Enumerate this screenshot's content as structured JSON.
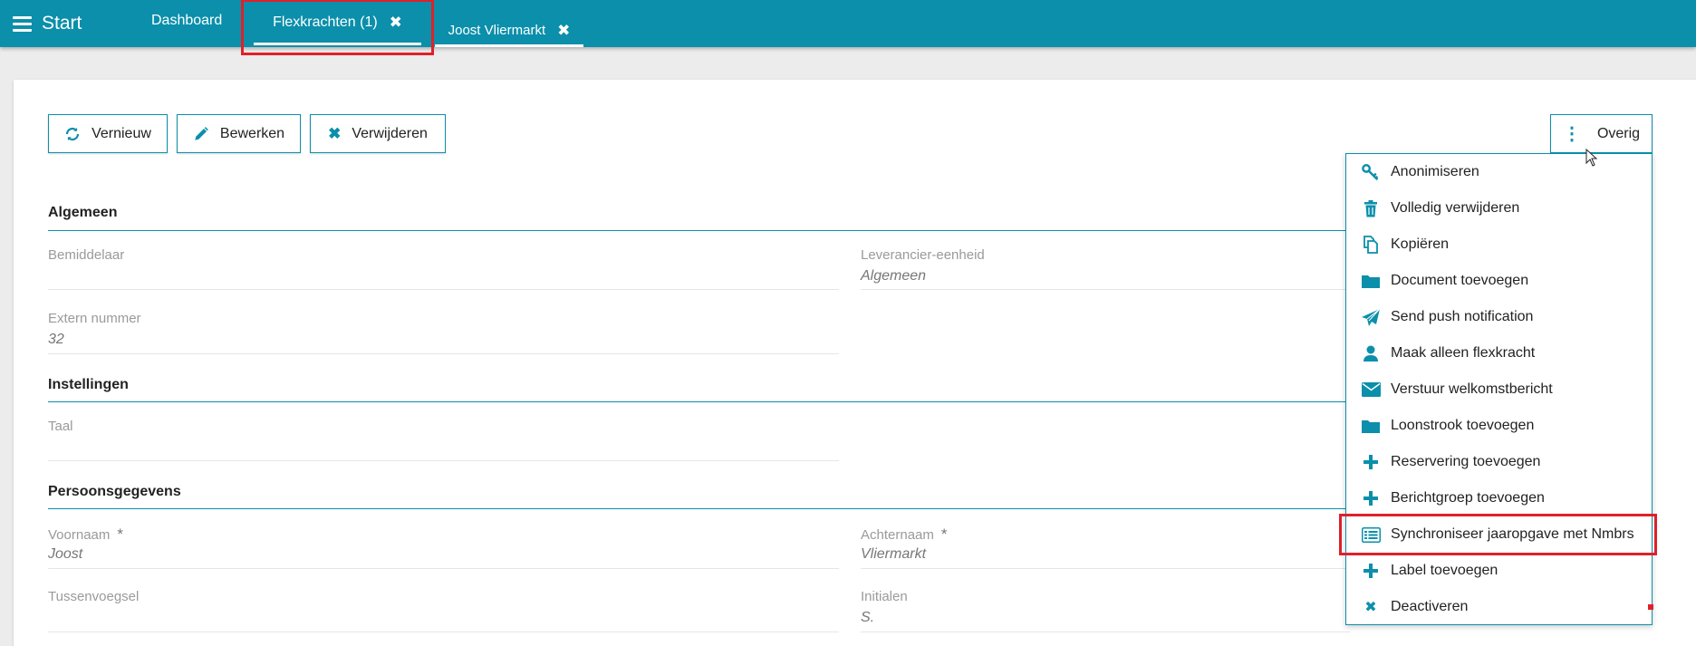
{
  "topbar": {
    "start_label": "Start",
    "tabs": [
      {
        "label": "Dashboard"
      },
      {
        "label": "Flexkrachten (1)"
      },
      {
        "label": "Joost Vliermarkt"
      }
    ]
  },
  "toolbar": {
    "refresh_label": "Vernieuw",
    "edit_label": "Bewerken",
    "delete_label": "Verwijderen",
    "more_label": "Overig"
  },
  "sections": {
    "general": {
      "title": "Algemeen",
      "bemiddelaar_label": "Bemiddelaar",
      "bemiddelaar_value": "",
      "leverancier_label": "Leverancier-eenheid",
      "leverancier_value": "Algemeen",
      "extern_label": "Extern nummer",
      "extern_value": "32"
    },
    "settings": {
      "title": "Instellingen",
      "taal_label": "Taal",
      "taal_value": ""
    },
    "personal": {
      "title": "Persoonsgegevens",
      "voornaam_label": "Voornaam",
      "voornaam_value": "Joost",
      "achternaam_label": "Achternaam",
      "achternaam_value": "Vliermarkt",
      "tussenvoegsel_label": "Tussenvoegsel",
      "tussenvoegsel_value": "",
      "initialen_label": "Initialen",
      "initialen_value": "S.",
      "required_mark": "*"
    }
  },
  "menu": {
    "items": [
      {
        "label": "Anonimiseren",
        "icon": "key-icon"
      },
      {
        "label": "Volledig verwijderen",
        "icon": "trash-icon"
      },
      {
        "label": "Kopiëren",
        "icon": "copy-icon"
      },
      {
        "label": "Document toevoegen",
        "icon": "folder-icon"
      },
      {
        "label": "Send push notification",
        "icon": "paper-plane-icon"
      },
      {
        "label": "Maak alleen flexkracht",
        "icon": "user-icon"
      },
      {
        "label": "Verstuur welkomstbericht",
        "icon": "envelope-icon"
      },
      {
        "label": "Loonstrook toevoegen",
        "icon": "folder-icon"
      },
      {
        "label": "Reservering toevoegen",
        "icon": "plus-icon"
      },
      {
        "label": "Berichtgroep toevoegen",
        "icon": "plus-icon"
      },
      {
        "label": "Synchroniseer jaaropgave met Nmbrs",
        "icon": "list-icon"
      },
      {
        "label": "Label toevoegen",
        "icon": "plus-icon"
      },
      {
        "label": "Deactiveren",
        "icon": "close-icon"
      }
    ]
  },
  "colors": {
    "accent": "#0b8fab",
    "highlight": "#e0202a"
  }
}
